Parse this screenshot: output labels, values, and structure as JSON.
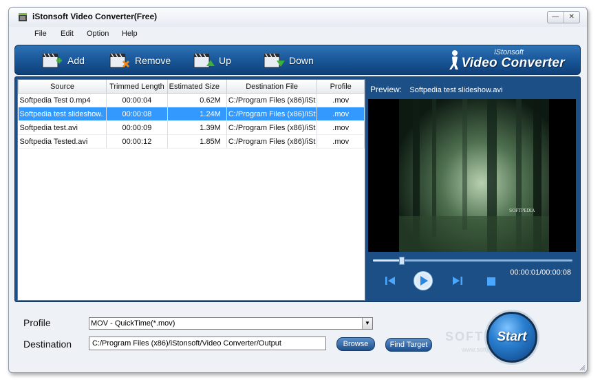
{
  "window": {
    "title": "iStonsoft Video Converter(Free)"
  },
  "menu": [
    "File",
    "Edit",
    "Option",
    "Help"
  ],
  "toolbar": {
    "add_label": "Add",
    "remove_label": "Remove",
    "up_label": "Up",
    "down_label": "Down",
    "brand_small": "iStonsoft",
    "brand_large": "Video Converter"
  },
  "table": {
    "headers": [
      "Source",
      "Trimmed Length",
      "Estimated Size",
      "Destination File",
      "Profile"
    ],
    "rows": [
      {
        "source": "Softpedia Test 0.mp4",
        "trimmed": "00:00:04",
        "size": "0.62M",
        "dest": "C:/Program Files (x86)/iSt",
        "profile": ".mov",
        "selected": false
      },
      {
        "source": "Softpedia test slideshow.",
        "trimmed": "00:00:08",
        "size": "1.24M",
        "dest": "C:/Program Files (x86)/iSt",
        "profile": ".mov",
        "selected": true
      },
      {
        "source": "Softpedia test.avi",
        "trimmed": "00:00:09",
        "size": "1.39M",
        "dest": "C:/Program Files (x86)/iSt",
        "profile": ".mov",
        "selected": false
      },
      {
        "source": "Softpedia Tested.avi",
        "trimmed": "00:00:12",
        "size": "1.85M",
        "dest": "C:/Program Files (x86)/iSt",
        "profile": ".mov",
        "selected": false
      }
    ]
  },
  "preview": {
    "label": "Preview:",
    "file": "Softpedia test slideshow.avi",
    "video_caption": "SOFTPEDIA",
    "timecode": "00:00:01/00:00:08",
    "progress": 0.14
  },
  "bottom": {
    "profile_label": "Profile",
    "profile_value": "MOV - QuickTime(*.mov)",
    "destination_label": "Destination",
    "destination_value": "C:/Program Files (x86)/iStonsoft/Video Converter/Output",
    "browse_label": "Browse",
    "find_target_label": "Find Target",
    "start_label": "Start",
    "watermark": "SOFTPEDIA",
    "watermark_url": "www.softpedia.com"
  },
  "colors": {
    "toolbar": "#1b5a9c",
    "panel": "#1c4f86",
    "selection": "#3399ff"
  }
}
